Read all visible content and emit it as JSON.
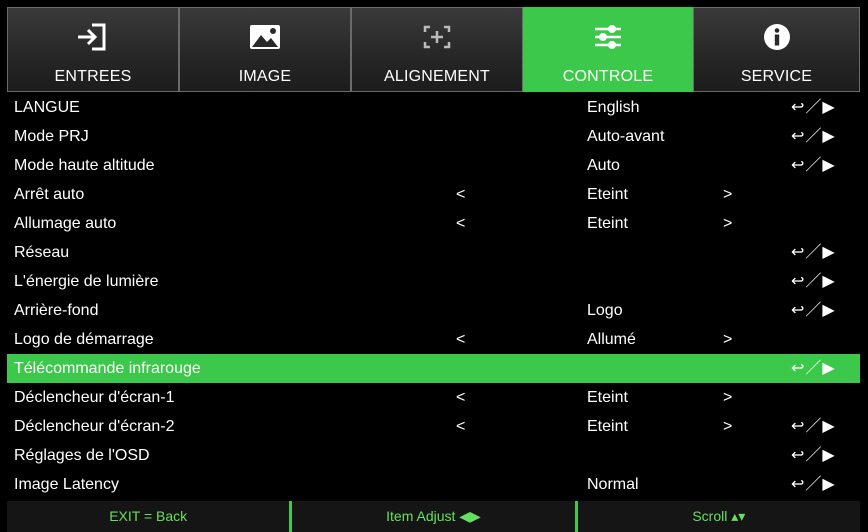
{
  "tabs": [
    {
      "label": "ENTREES",
      "icon": "input-icon",
      "active": false
    },
    {
      "label": "IMAGE",
      "icon": "image-icon",
      "active": false
    },
    {
      "label": "ALIGNEMENT",
      "icon": "alignment-icon",
      "active": false
    },
    {
      "label": "CONTROLE",
      "icon": "sliders-icon",
      "active": true
    },
    {
      "label": "SERVICE",
      "icon": "info-icon",
      "active": false
    }
  ],
  "rows": [
    {
      "name": "LANGUE",
      "value": "English",
      "enter": "↩／▶"
    },
    {
      "name": "Mode PRJ",
      "value": "Auto-avant",
      "enter": "↩／▶"
    },
    {
      "name": "Mode haute altitude",
      "value": "Auto",
      "enter": "↩／▶"
    },
    {
      "name": "Arrêt auto",
      "left": "<",
      "value": "Eteint",
      "right": ">"
    },
    {
      "name": "Allumage auto",
      "left": "<",
      "value": "Eteint",
      "right": ">"
    },
    {
      "name": "Réseau",
      "enter": "↩／▶"
    },
    {
      "name": "L'énergie de lumière",
      "enter": "↩／▶"
    },
    {
      "name": "Arrière-fond",
      "value": "Logo",
      "enter": "↩／▶"
    },
    {
      "name": "Logo de démarrage",
      "left": "<",
      "value": "Allumé",
      "right": ">"
    },
    {
      "name": "Télécommande infrarouge",
      "enter": "↩／▶",
      "selected": true
    },
    {
      "name": "Déclencheur d'écran-1",
      "left": "<",
      "value": "Eteint",
      "right": ">"
    },
    {
      "name": "Déclencheur d'écran-2",
      "left": "<",
      "value": "Eteint",
      "right": ">",
      "enter": "↩／▶"
    },
    {
      "name": "Réglages de l'OSD",
      "enter": "↩／▶"
    },
    {
      "name": "Image Latency",
      "value": "Normal",
      "enter": "↩／▶"
    }
  ],
  "footer": {
    "back": "EXIT = Back",
    "adjust": "Item Adjust ◀▶",
    "scroll": "Scroll ▴▾"
  },
  "colors": {
    "accent": "#3cc84a",
    "footer_text": "#66e060"
  }
}
